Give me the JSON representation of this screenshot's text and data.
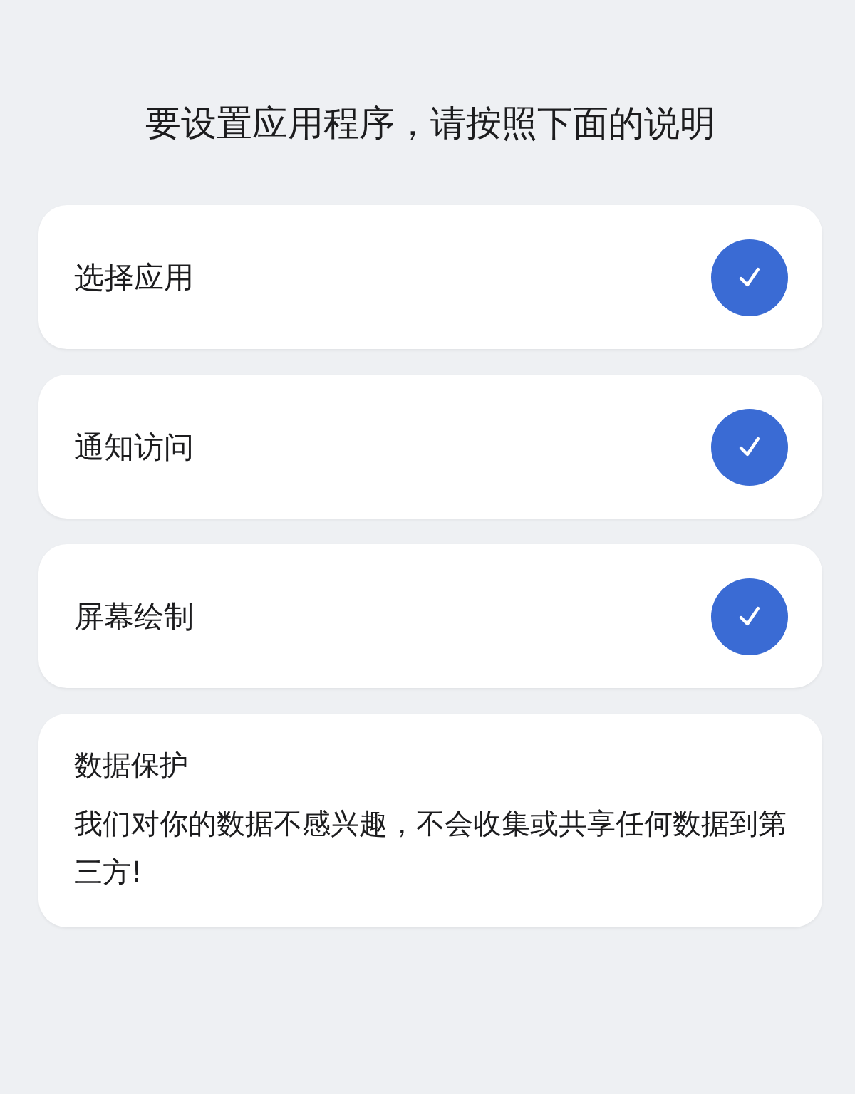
{
  "title": "要设置应用程序，请按照下面的说明",
  "steps": [
    {
      "label": "选择应用",
      "checked": true
    },
    {
      "label": "通知访问",
      "checked": true
    },
    {
      "label": "屏幕绘制",
      "checked": true
    }
  ],
  "info": {
    "title": "数据保护",
    "text": "我们对你的数据不感兴趣，不会收集或共享任何数据到第三方!"
  }
}
